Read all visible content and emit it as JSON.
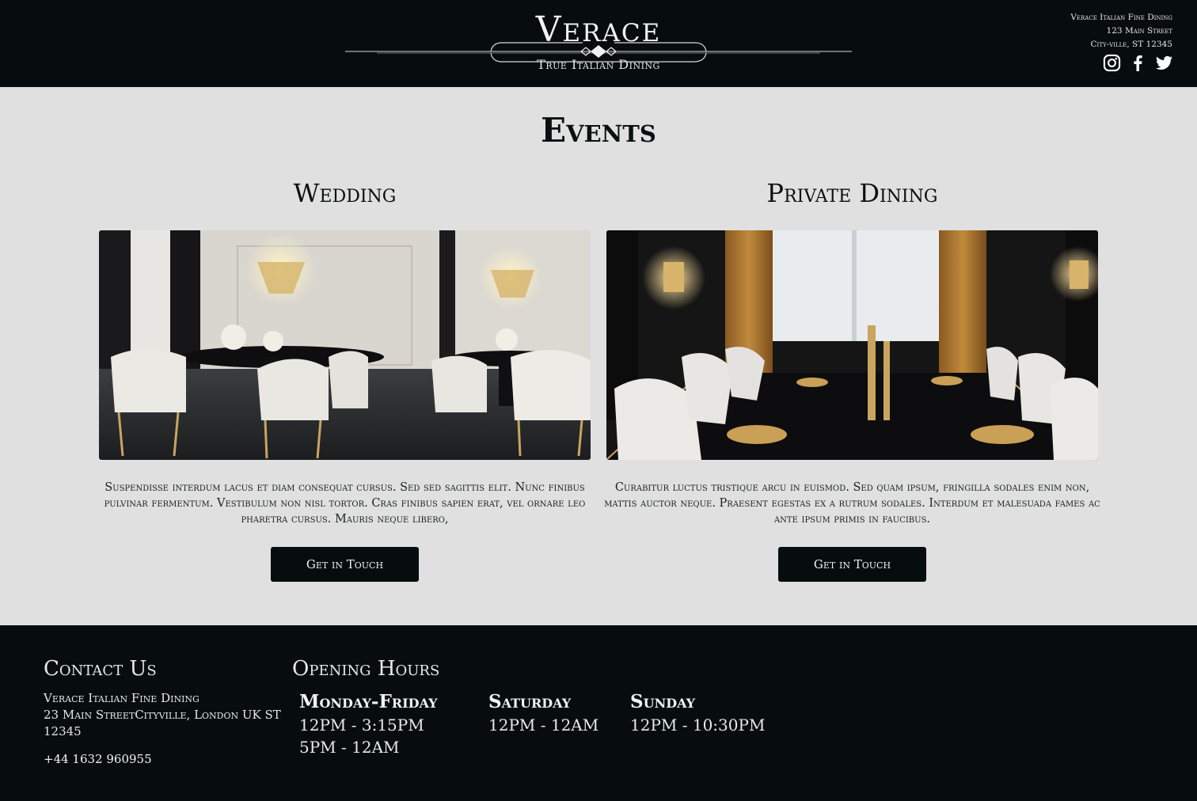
{
  "header": {
    "logo_title": "Verace",
    "logo_subtitle": "True Italian Dining",
    "address": [
      "Verace Italian Fine Dining",
      "123 Main Street",
      "City-ville, ST 12345"
    ],
    "social": [
      "instagram-icon",
      "facebook-icon",
      "twitter-icon"
    ]
  },
  "main": {
    "title": "Events",
    "cards": [
      {
        "title": "Wedding",
        "image": "wedding-dining-room-image",
        "description": "Suspendisse interdum lacus et diam consequat cursus. Sed sed sagittis elit. Nunc finibus pulvinar fermentum. Vestibulum non nisl tortor. Cras finibus sapien erat, vel ornare leo pharetra cursus. Mauris neque libero,",
        "button": "Get in Touch"
      },
      {
        "title": "Private Dining",
        "image": "private-dining-room-image",
        "description": "Curabitur luctus tristique arcu in euismod. Sed quam ipsum, fringilla sodales enim non, mattis auctor neque. Praesent egestas ex a rutrum sodales. Interdum et malesuada fames ac ante ipsum primis in faucibus.",
        "button": "Get in Touch"
      }
    ]
  },
  "footer": {
    "contact_title": "Contact Us",
    "contact_lines": [
      "Verace Italian Fine Dining",
      "23 Main StreetCityville, London UK ST 12345"
    ],
    "phone": "+44 1632 960955",
    "hours_title": "Opening Hours",
    "hours": [
      {
        "day": "Monday-Friday",
        "times": [
          "12PM - 3:15PM",
          "5PM - 12AM"
        ]
      },
      {
        "day": "Saturday",
        "times": [
          "12PM - 12AM"
        ]
      },
      {
        "day": "Sunday",
        "times": [
          "12PM - 10:30PM"
        ]
      }
    ]
  },
  "colors": {
    "dark": "#070d0e",
    "page_background": "#e0e0e0",
    "light_text": "#e8e8e8"
  }
}
